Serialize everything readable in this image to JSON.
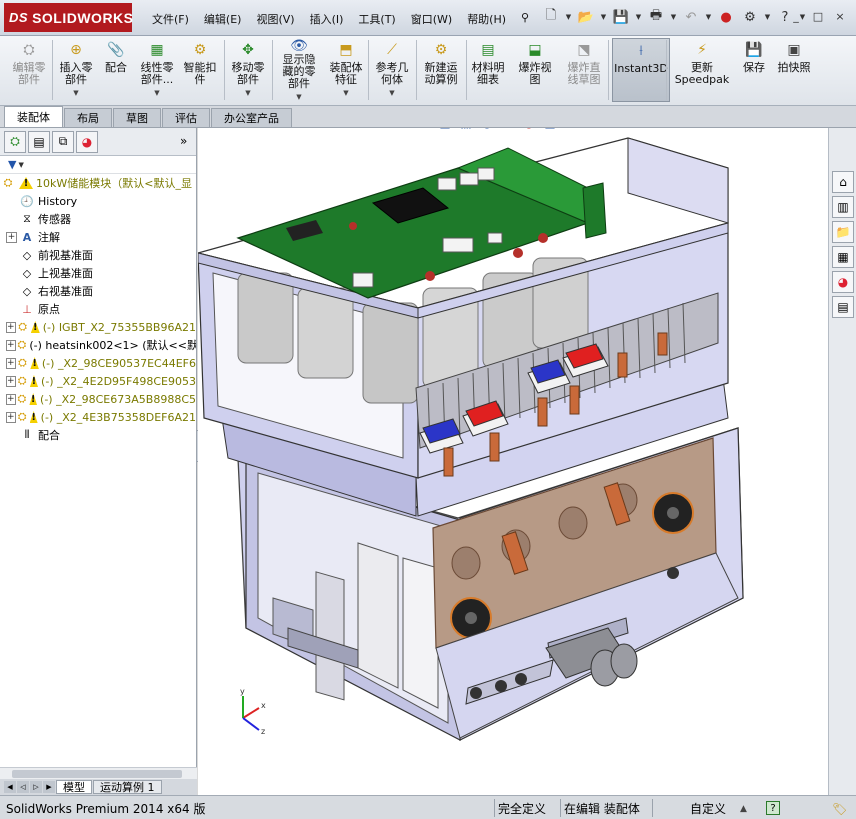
{
  "app": {
    "logo_ds": "DS",
    "logo_text": "SOLIDWORKS"
  },
  "menu": [
    "文件(F)",
    "编辑(E)",
    "视图(V)",
    "插入(I)",
    "工具(T)",
    "窗口(W)",
    "帮助(H)"
  ],
  "window_controls": [
    "_",
    "□",
    "×"
  ],
  "ribbon": [
    {
      "label": "编辑零\n部件",
      "icon": "edit-component-icon",
      "disabled": true
    },
    {
      "label": "插入零\n部件",
      "icon": "insert-component-icon",
      "disabled": false
    },
    {
      "label": "配合",
      "icon": "mate-icon",
      "disabled": false
    },
    {
      "label": "线性零\n部件...",
      "icon": "linear-pattern-icon",
      "disabled": false
    },
    {
      "label": "智能扣\n件",
      "icon": "smart-fastener-icon",
      "disabled": false
    },
    {
      "label": "移动零\n部件",
      "icon": "move-component-icon",
      "disabled": false
    },
    {
      "label": "显示隐\n藏的零\n部件",
      "icon": "show-hidden-icon",
      "disabled": false
    },
    {
      "label": "装配体\n特征",
      "icon": "assembly-feature-icon",
      "disabled": false
    },
    {
      "label": "参考几\n何体",
      "icon": "reference-geometry-icon",
      "disabled": false
    },
    {
      "label": "新建运\n动算例",
      "icon": "motion-study-icon",
      "disabled": false
    },
    {
      "label": "材料明\n细表",
      "icon": "bom-icon",
      "disabled": false
    },
    {
      "label": "爆炸视\n图",
      "icon": "exploded-view-icon",
      "disabled": false
    },
    {
      "label": "爆炸直\n线草图",
      "icon": "explode-line-icon",
      "disabled": true
    },
    {
      "label": "Instant3D",
      "icon": "instant3d-icon",
      "disabled": false
    },
    {
      "label": "更新\nSpeedpak",
      "icon": "speedpak-icon",
      "disabled": false
    },
    {
      "label": "保存",
      "icon": "save-icon",
      "disabled": false
    },
    {
      "label": "拍快照",
      "icon": "snapshot-icon",
      "disabled": false
    }
  ],
  "tabs": [
    "装配体",
    "布局",
    "草图",
    "评估",
    "办公室产品"
  ],
  "tree": {
    "root": "10kW储能模块（默认<默认_显",
    "items": [
      {
        "label": "History",
        "type": "history",
        "exp": false
      },
      {
        "label": "传感器",
        "type": "sensor",
        "exp": false
      },
      {
        "label": "注解",
        "type": "annotation",
        "exp": true
      },
      {
        "label": "前视基准面",
        "type": "plane",
        "exp": false
      },
      {
        "label": "上视基准面",
        "type": "plane",
        "exp": false
      },
      {
        "label": "右视基准面",
        "type": "plane",
        "exp": false
      },
      {
        "label": "原点",
        "type": "origin",
        "exp": false
      },
      {
        "label": "(-) IGBT_X2_75355BB96A21",
        "type": "warnpart",
        "exp": true
      },
      {
        "label": "(-) heatsink002<1> (默认<<默",
        "type": "part",
        "exp": true
      },
      {
        "label": "(-) _X2_98CE90537EC44EF6",
        "type": "warnpart",
        "exp": true
      },
      {
        "label": "(-) _X2_4E2D95F498CE9053",
        "type": "warnpart",
        "exp": true
      },
      {
        "label": "(-) _X2_98CE673A5B8988C5",
        "type": "warnpart",
        "exp": true
      },
      {
        "label": "(-) _X2_4E3B75358DEF6A21",
        "type": "warnpart",
        "exp": true
      },
      {
        "label": "配合",
        "type": "mates",
        "exp": false
      }
    ]
  },
  "bottom_tabs": [
    "模型",
    "运动算例 1"
  ],
  "status": {
    "app": "SolidWorks Premium 2014 x64 版",
    "defined": "完全定义",
    "editing": "在编辑 装配体",
    "custom": "自定义",
    "help": "?"
  },
  "colors": {
    "brand": "#b21a1f",
    "pcb": "#1e7a2a",
    "frame": "#c8c9ea",
    "copper": "#c96a3a",
    "plate": "#b79a86"
  }
}
